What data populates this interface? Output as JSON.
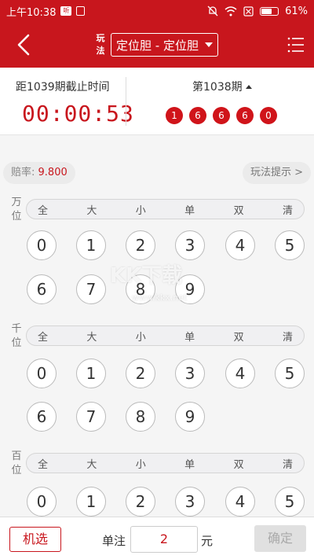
{
  "status_bar": {
    "time": "上午10:38",
    "badge": "听",
    "battery": "61%"
  },
  "header": {
    "play_label": "玩法",
    "play_select": "定位胆 - 定位胆"
  },
  "issue_info": {
    "deadline_label": "距1039期截止时间",
    "countdown": "00:00:53",
    "last_issue_label": "第1038期",
    "last_numbers": [
      "1",
      "6",
      "6",
      "6",
      "0"
    ]
  },
  "odds": {
    "label": "赔率:",
    "value": "9.800",
    "hint": "玩法提示 >"
  },
  "quick_options": [
    "全",
    "大",
    "小",
    "单",
    "双",
    "清"
  ],
  "sections": [
    {
      "label_top": "万",
      "label_bottom": "位",
      "numbers": [
        "0",
        "1",
        "2",
        "3",
        "4",
        "5",
        "6",
        "7",
        "8",
        "9"
      ]
    },
    {
      "label_top": "千",
      "label_bottom": "位",
      "numbers": [
        "0",
        "1",
        "2",
        "3",
        "4",
        "5",
        "6",
        "7",
        "8",
        "9"
      ]
    },
    {
      "label_top": "百",
      "label_bottom": "位",
      "numbers": [
        "0",
        "1",
        "2",
        "3",
        "4",
        "5"
      ]
    }
  ],
  "watermark": {
    "main": "KK下载",
    "sub": "www.kkx.net"
  },
  "bottom_bar": {
    "random_label": "机选",
    "unit_label": "单注",
    "unit_value": "2",
    "yuan_label": "元",
    "confirm_label": "确定"
  },
  "colors": {
    "brand_red": "#c8161d",
    "ball_red": "#d0141a"
  }
}
